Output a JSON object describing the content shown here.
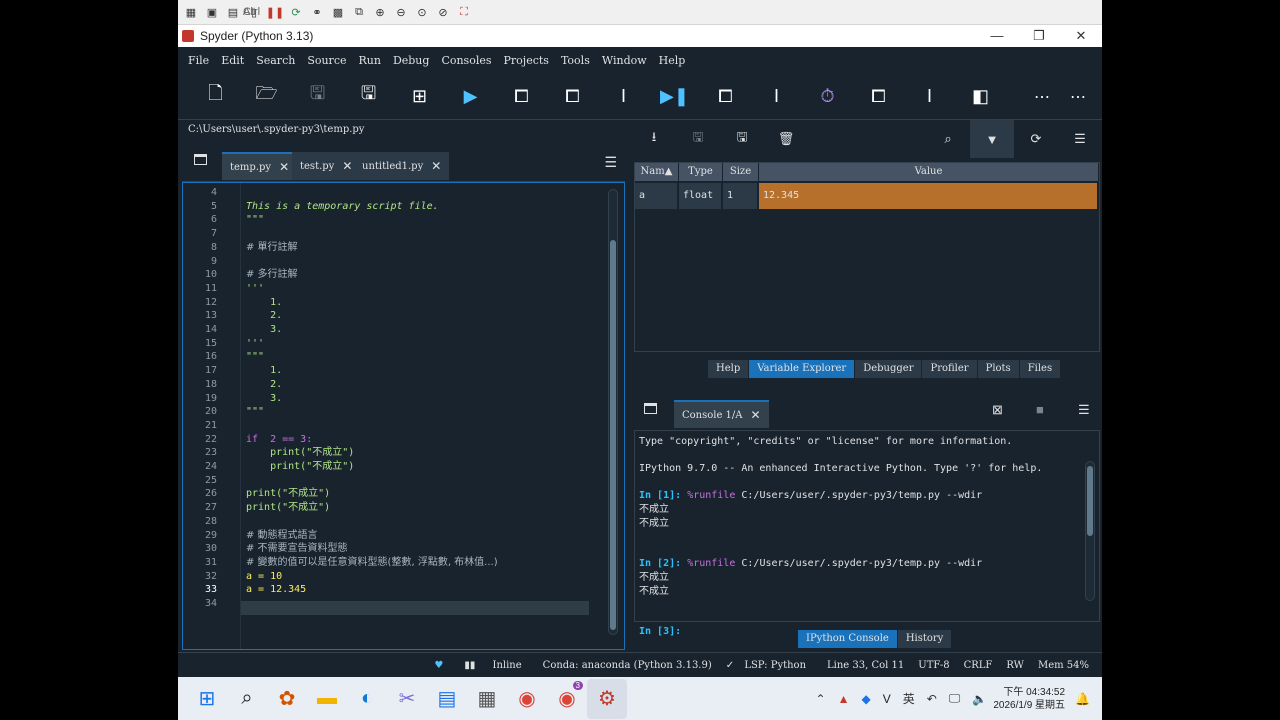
{
  "window": {
    "title": "Spyder (Python 3.13)"
  },
  "menu": [
    "File",
    "Edit",
    "Search",
    "Source",
    "Run",
    "Debug",
    "Consoles",
    "Projects",
    "Tools",
    "Window",
    "Help"
  ],
  "ext_toolbar": {
    "ctrl_label": "Ctrl",
    "alt_label": "Alt"
  },
  "editor": {
    "path": "C:\\Users\\user\\.spyder-py3\\temp.py",
    "tabs": [
      {
        "label": "temp.py",
        "active": true
      },
      {
        "label": "test.py",
        "active": false
      },
      {
        "label": "untitled1.py",
        "active": false
      }
    ],
    "lines": [
      {
        "n": "4",
        "text": ""
      },
      {
        "n": "5",
        "text": "This is a temporary script file.",
        "kind": "docital"
      },
      {
        "n": "6",
        "text": "\"\"\"",
        "kind": "str"
      },
      {
        "n": "7",
        "text": ""
      },
      {
        "n": "8",
        "text": "# 單行註解",
        "kind": "cmt"
      },
      {
        "n": "9",
        "text": ""
      },
      {
        "n": "10",
        "text": "# 多行註解",
        "kind": "cmt"
      },
      {
        "n": "11",
        "text": "'''",
        "kind": "str"
      },
      {
        "n": "12",
        "text": "    1.",
        "kind": "str"
      },
      {
        "n": "13",
        "text": "    2.",
        "kind": "str"
      },
      {
        "n": "14",
        "text": "    3.",
        "kind": "str"
      },
      {
        "n": "15",
        "text": "'''",
        "kind": "str"
      },
      {
        "n": "16",
        "text": "\"\"\"",
        "kind": "str"
      },
      {
        "n": "17",
        "text": "    1.",
        "kind": "str"
      },
      {
        "n": "18",
        "text": "    2.",
        "kind": "str"
      },
      {
        "n": "19",
        "text": "    3.",
        "kind": "str"
      },
      {
        "n": "20",
        "text": "\"\"\"",
        "kind": "str"
      },
      {
        "n": "21",
        "text": ""
      },
      {
        "n": "22",
        "text": "if  2 == 3:",
        "kind": "if"
      },
      {
        "n": "23",
        "text": "    print(\"不成立\")",
        "kind": "print"
      },
      {
        "n": "24",
        "text": "    print(\"不成立\")",
        "kind": "print"
      },
      {
        "n": "25",
        "text": ""
      },
      {
        "n": "26",
        "text": "print(\"不成立\")",
        "kind": "print"
      },
      {
        "n": "27",
        "text": "print(\"不成立\")",
        "kind": "print"
      },
      {
        "n": "28",
        "text": ""
      },
      {
        "n": "29",
        "text": "# 動態程式語言",
        "kind": "cmt"
      },
      {
        "n": "30",
        "text": "# 不需要宣告資料型態",
        "kind": "cmt"
      },
      {
        "n": "31",
        "text": "# 變數的值可以是任意資料型態(整數, 浮點數, 布林值...)",
        "kind": "cmt"
      },
      {
        "n": "32",
        "text": "a = 10",
        "kind": "assign"
      },
      {
        "n": "33",
        "text": "a = 12.345",
        "kind": "assign",
        "current": true
      },
      {
        "n": "34",
        "text": ""
      }
    ]
  },
  "variable_explorer": {
    "columns": [
      "Nam",
      "Type",
      "Size",
      "Value"
    ],
    "rows": [
      {
        "name": "a",
        "type": "float",
        "size": "1",
        "value": "12.345"
      }
    ],
    "pane_tabs": [
      "Help",
      "Variable Explorer",
      "Debugger",
      "Profiler",
      "Plots",
      "Files"
    ],
    "active_tab": "Variable Explorer"
  },
  "console": {
    "tab_label": "Console 1/A",
    "lines": [
      {
        "text": "Type \"copyright\", \"credits\" or \"license\" for more information."
      },
      {
        "text": ""
      },
      {
        "text": "IPython 9.7.0 -- An enhanced Interactive Python. Type '?' for help."
      },
      {
        "text": ""
      },
      {
        "prompt": "In [1]:",
        "magic": "%runfile",
        "rest": " C:/Users/user/.spyder-py3/temp.py --wdir"
      },
      {
        "text": "不成立",
        "cjk": true
      },
      {
        "text": "不成立",
        "cjk": true
      },
      {
        "text": ""
      },
      {
        "text": ""
      },
      {
        "prompt": "In [2]:",
        "magic": "%runfile",
        "rest": " C:/Users/user/.spyder-py3/temp.py --wdir"
      },
      {
        "text": "不成立",
        "cjk": true
      },
      {
        "text": "不成立",
        "cjk": true
      },
      {
        "text": ""
      },
      {
        "text": ""
      },
      {
        "prompt": "In [3]:",
        "magic": "",
        "rest": ""
      }
    ],
    "pane_tabs": [
      "IPython Console",
      "History"
    ],
    "active_tab": "IPython Console"
  },
  "status": {
    "inline": "Inline",
    "conda": "Conda: anaconda (Python 3.13.9)",
    "lsp": "LSP: Python",
    "position": "Line 33, Col 11",
    "encoding": "UTF-8",
    "eol": "CRLF",
    "rw": "RW",
    "mem": "Mem 54%"
  },
  "taskbar": {
    "ime": "英",
    "time": "下午 04:34:52",
    "date": "2026/1/9 星期五",
    "chrome_badge": "3"
  },
  "colors": {
    "accent": "#1a72bb",
    "value_highlight": "#b6702b",
    "background": "#19232d"
  }
}
